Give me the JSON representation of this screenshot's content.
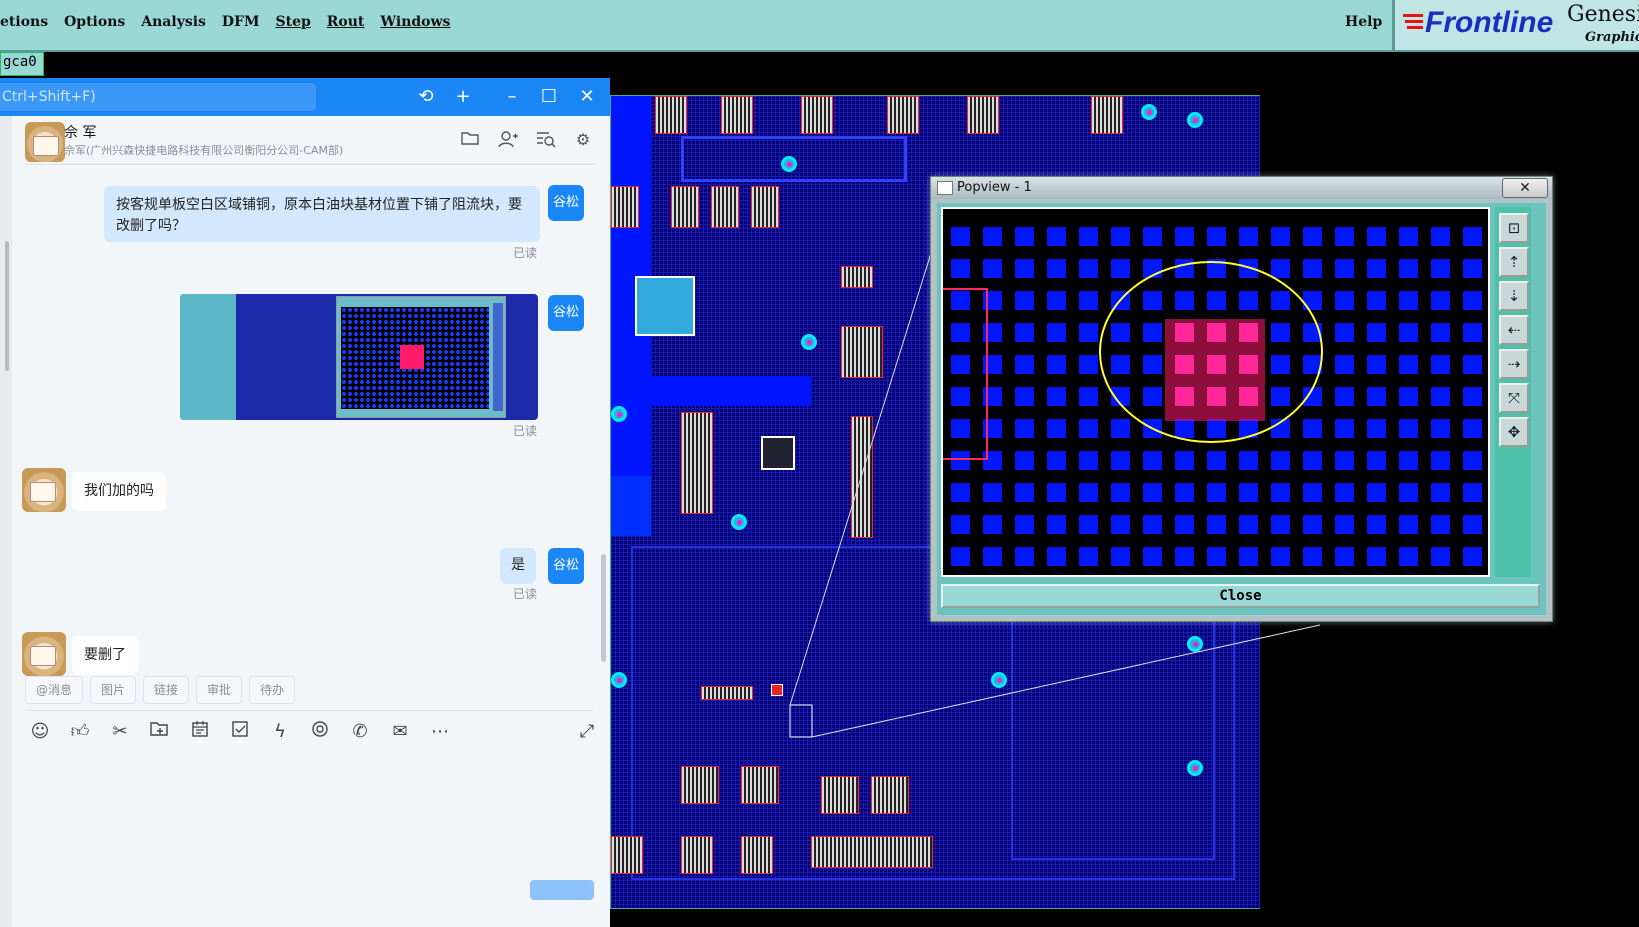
{
  "menubar": {
    "items": [
      "etions",
      "Options",
      "Analysis",
      "DFM",
      "Step",
      "Rout",
      "Windows"
    ],
    "help": "Help",
    "brand": {
      "frontline": "Frontline",
      "genesis": "Genesis",
      "graphic": "Graphic"
    }
  },
  "job_tab": "gca0",
  "chat": {
    "search_placeholder": "Ctrl+Shift+F)",
    "top_icons": [
      "history-icon",
      "plus-icon",
      "minimize-icon",
      "maximize-icon",
      "close-icon"
    ],
    "contact": {
      "name": "佘 军",
      "subtitle": "佘军(广州兴森快捷电路科技有限公司衡阳分公司-CAM部)"
    },
    "header_icons": [
      "folder-icon",
      "add-user-icon",
      "search-list-icon",
      "settings-icon"
    ],
    "me_avatar": "谷松",
    "messages": [
      {
        "from": "me",
        "text": "按客规单板空白区域铺铜，原本白油块基材位置下铺了阻流块，要改删了吗？",
        "status": "已读"
      },
      {
        "from": "me",
        "type": "image",
        "status": "已读"
      },
      {
        "from": "other",
        "text": "我们加的吗"
      },
      {
        "from": "me",
        "text": "是",
        "status": "已读"
      },
      {
        "from": "other",
        "text": "要删了"
      }
    ],
    "quick_tags": [
      "@消息",
      "图片",
      "链接",
      "审批",
      "待办"
    ],
    "toolbar_icons": [
      "emoji-icon",
      "thumbs-up-icon",
      "scissors-icon",
      "folder-add-icon",
      "calendar-icon",
      "checkbox-icon",
      "lightning-icon",
      "record-icon",
      "phone-icon",
      "mail-icon",
      "more-icon",
      "expand-icon"
    ]
  },
  "popview": {
    "title": "Popview - 1",
    "close_x": "✕",
    "close_label": "Close",
    "side_buttons": [
      "zoom-area-icon",
      "pan-up-icon",
      "pan-down-icon",
      "pan-left-icon",
      "pan-right-icon",
      "zoom-fit-icon",
      "zoom-out-icon"
    ]
  },
  "colors": {
    "menubar": "#9ad8d6",
    "chat_blue": "#1b86f5",
    "pcb_pad_blue": "#0016ff",
    "pcb_highlight_pink": "#ff1a6a",
    "ellipse_yellow": "#ffff33"
  }
}
